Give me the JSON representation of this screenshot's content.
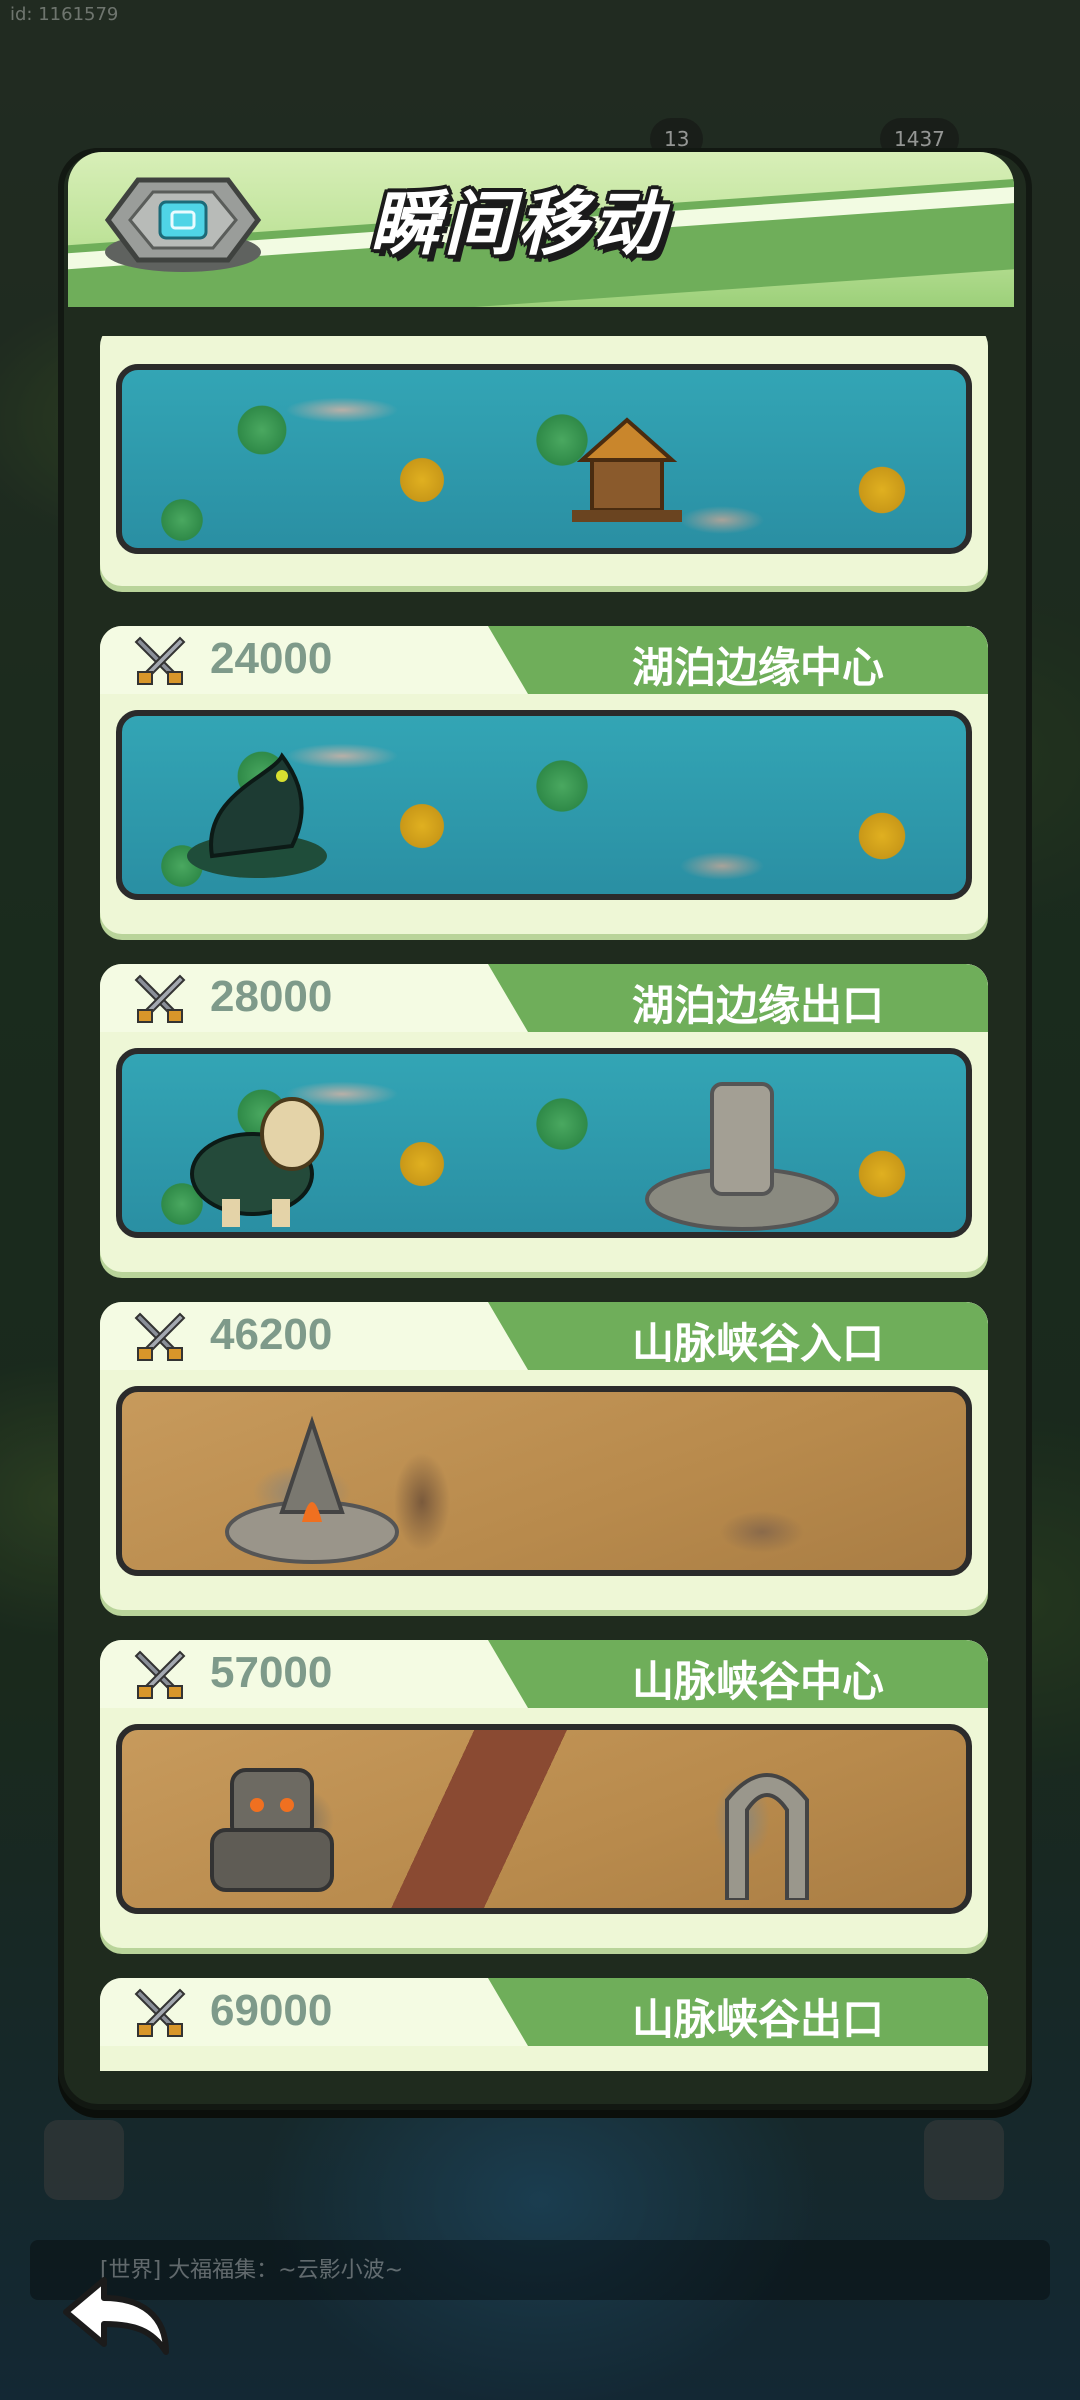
{
  "dialog": {
    "title": "瞬间移动"
  },
  "background": {
    "player_id": "id: 1161579",
    "resources": [
      "13",
      "1437"
    ],
    "chat_preview": "[世界] 大福福集：~云影小波~"
  },
  "locations": [
    {
      "name": "",
      "power": "",
      "scene": "lake"
    },
    {
      "name": "湖泊边缘中心",
      "power": "24000",
      "scene": "lake"
    },
    {
      "name": "湖泊边缘出口",
      "power": "28000",
      "scene": "lake"
    },
    {
      "name": "山脉峡谷入口",
      "power": "46200",
      "scene": "desert"
    },
    {
      "name": "山脉峡谷中心",
      "power": "57000",
      "scene": "canyon"
    },
    {
      "name": "山脉峡谷出口",
      "power": "69000",
      "scene": "canyon"
    }
  ],
  "icons": {
    "portal": "portal-stone-icon",
    "power": "crossed-swords-icon",
    "back": "back-arrow-icon"
  },
  "colors": {
    "header_green": "#6fae5a",
    "card_bg": "#eef7d6",
    "power_text": "#7e9a8a"
  }
}
